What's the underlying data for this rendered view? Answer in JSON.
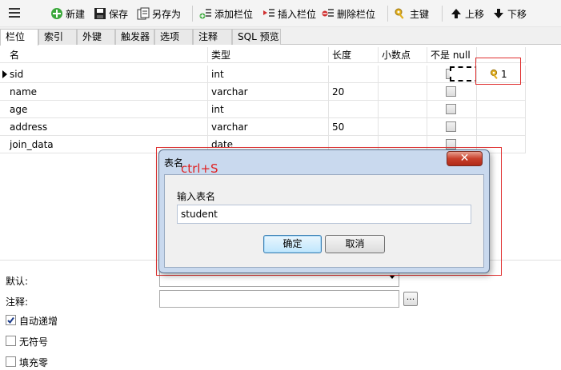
{
  "toolbar": {
    "buttons": {
      "new": "新建",
      "save": "保存",
      "save_as": "另存为",
      "add_field": "添加栏位",
      "insert_field": "插入栏位",
      "delete_field": "删除栏位",
      "primary_key": "主键",
      "move_up": "上移",
      "move_down": "下移"
    }
  },
  "tabs": [
    "栏位",
    "索引",
    "外键",
    "触发器",
    "选项",
    "注释",
    "SQL 预览"
  ],
  "grid": {
    "columns": [
      "名",
      "类型",
      "长度",
      "小数点",
      "不是 null"
    ],
    "rows": [
      {
        "name": "sid",
        "type": "int",
        "length": "",
        "decimals": "",
        "key_label": "1"
      },
      {
        "name": "name",
        "type": "varchar",
        "length": "20",
        "decimals": "",
        "key_label": ""
      },
      {
        "name": "age",
        "type": "int",
        "length": "",
        "decimals": "",
        "key_label": ""
      },
      {
        "name": "address",
        "type": "varchar",
        "length": "50",
        "decimals": "",
        "key_label": ""
      },
      {
        "name": "join_data",
        "type": "date",
        "length": "",
        "decimals": "",
        "key_label": ""
      }
    ]
  },
  "properties": {
    "default_label": "默认:",
    "comment_label": "注释:",
    "ellipsis": "...",
    "auto_increment": "自动递增",
    "unsigned": "无符号",
    "zerofill": "填充零"
  },
  "dialog": {
    "title": "表名",
    "hint": "ctrl+S",
    "close": "✕",
    "prompt": "输入表名",
    "value": "student",
    "ok": "确定",
    "cancel": "取消"
  },
  "colors": {
    "annotation_red": "#e03030",
    "dialog_frame": "#c9d9ee"
  }
}
